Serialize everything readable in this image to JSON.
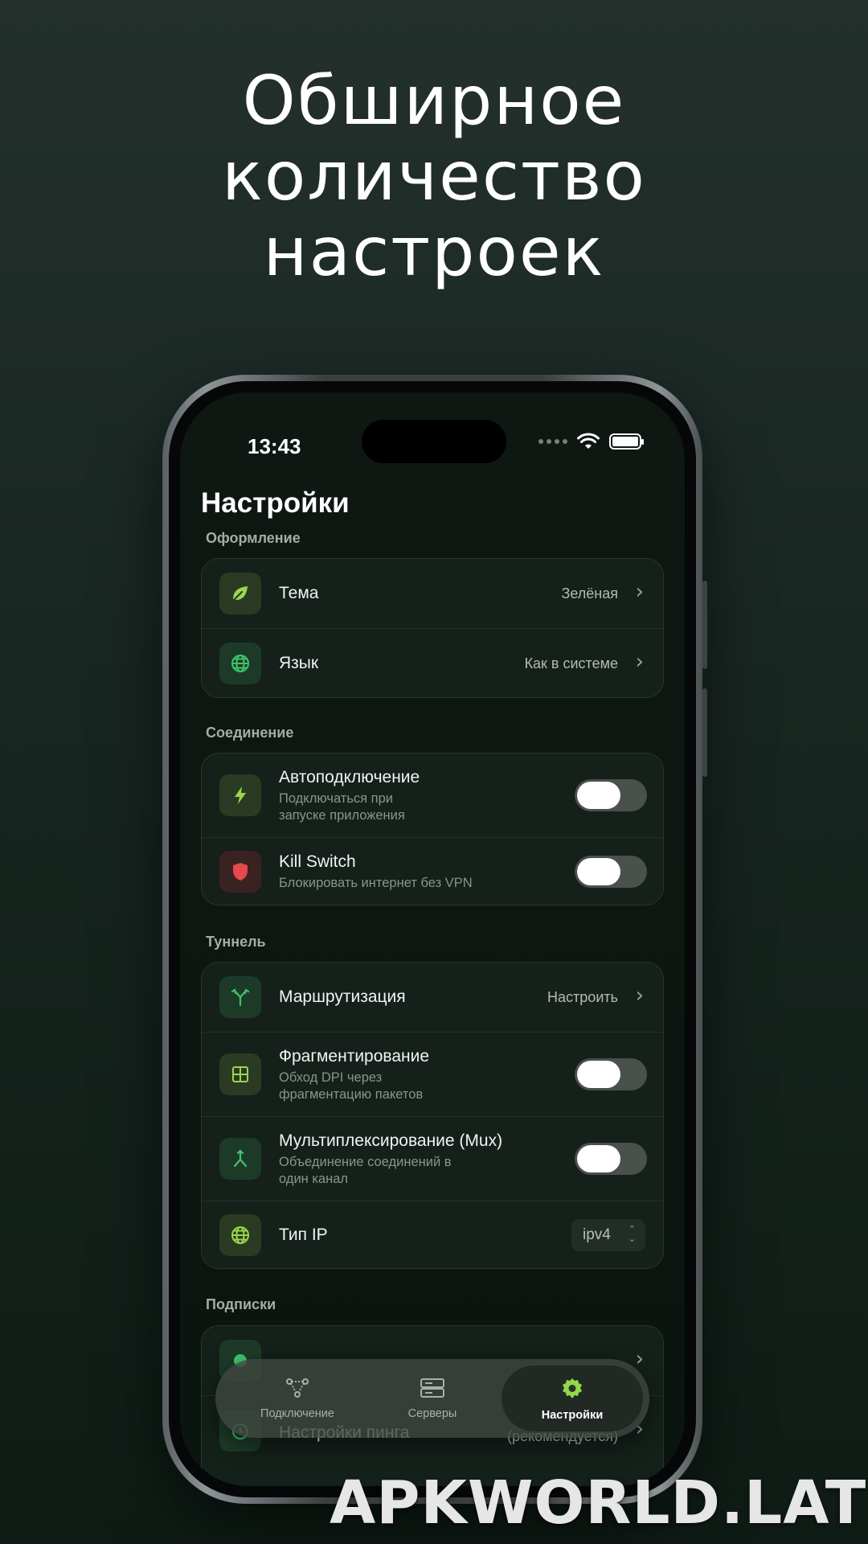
{
  "headline": [
    "Обширное",
    "количество",
    "настроек"
  ],
  "status": {
    "time": "13:43"
  },
  "page_title": "Настройки",
  "sections": {
    "appearance": {
      "label": "Оформление",
      "theme": {
        "title": "Тема",
        "value": "Зелёная",
        "icon": "leaf-icon"
      },
      "language": {
        "title": "Язык",
        "value": "Как в системе",
        "icon": "globe-icon"
      }
    },
    "connection": {
      "label": "Соединение",
      "autoconnect": {
        "title": "Автоподключение",
        "subtitle_line1": "Подключаться при",
        "subtitle_line2": "запуске приложения",
        "icon": "bolt-icon",
        "enabled": false
      },
      "kill_switch": {
        "title": "Kill Switch",
        "subtitle": "Блокировать интернет без VPN",
        "icon": "shield-icon",
        "enabled": false
      }
    },
    "tunnel": {
      "label": "Туннель",
      "routing": {
        "title": "Маршрутизация",
        "value": "Настроить",
        "icon": "split-route-icon"
      },
      "fragmentation": {
        "title": "Фрагментирование",
        "subtitle_line1": "Обход DPI через",
        "subtitle_line2": "фрагментацию пакетов",
        "icon": "grid-icon",
        "enabled": false
      },
      "mux": {
        "title": "Мультиплексирование (Mux)",
        "subtitle_line1": "Объединение соединений в",
        "subtitle_line2": "один канал",
        "icon": "merge-icon",
        "enabled": false
      },
      "ip_type": {
        "title": "Тип IP",
        "value": "ipv4",
        "icon": "globe-icon"
      }
    },
    "subscriptions": {
      "label": "Подписки",
      "ping_settings": {
        "title": "Настройки пинга",
        "value": "(рекомендуется)"
      }
    }
  },
  "tabbar": {
    "connection": "Подключение",
    "servers": "Серверы",
    "settings": "Настройки"
  },
  "colors": {
    "accent_green": "#8fd94a",
    "toggle_off": "#4a504c",
    "kill_switch_red": "#e5484d"
  },
  "watermark": "APKWORLD.LAT"
}
